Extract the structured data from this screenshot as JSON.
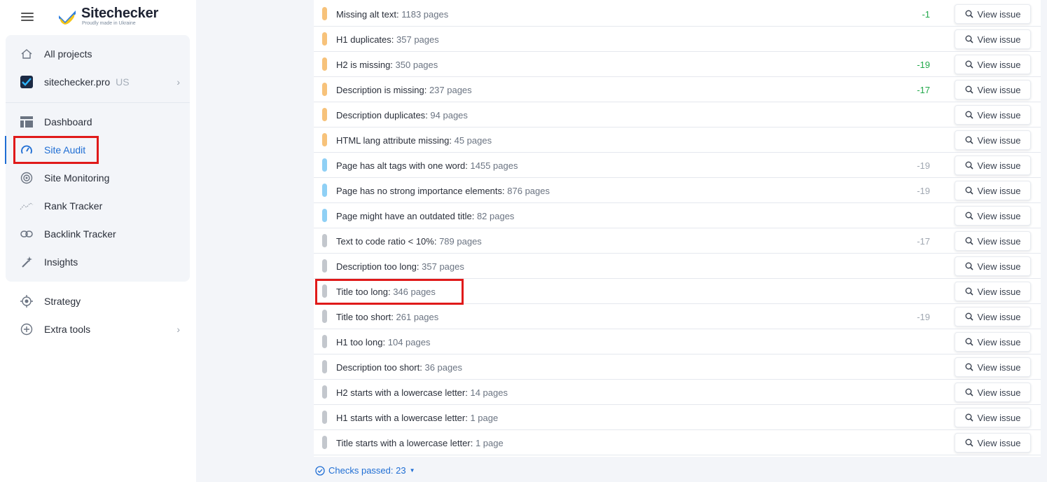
{
  "brand": {
    "name": "Sitechecker",
    "tagline": "Proudly made in Ukraine"
  },
  "sidebar": {
    "all_projects": "All projects",
    "project": {
      "name": "sitechecker.pro",
      "region": "US"
    },
    "items": [
      {
        "label": "Dashboard",
        "icon": "dashboard-icon"
      },
      {
        "label": "Site Audit",
        "icon": "gauge-icon"
      },
      {
        "label": "Site Monitoring",
        "icon": "monitoring-icon"
      },
      {
        "label": "Rank Tracker",
        "icon": "rank-icon"
      },
      {
        "label": "Backlink Tracker",
        "icon": "link-icon"
      },
      {
        "label": "Insights",
        "icon": "magic-wand-icon"
      }
    ],
    "strategy": "Strategy",
    "extra_tools": "Extra tools"
  },
  "colors": {
    "accent": "#1f6ed4",
    "warning": "#f7c27a",
    "notice": "#8fd0f5",
    "info": "#c3c7cd",
    "positive": "#21a84a",
    "neutral": "#a0a7b1",
    "highlight": "#e01a1a"
  },
  "issues": [
    {
      "name": "Missing alt text",
      "count": "1183 pages",
      "delta": "-1",
      "level": "warning",
      "delta_kind": "positive"
    },
    {
      "name": "H1 duplicates",
      "count": "357 pages",
      "delta": "",
      "level": "warning",
      "delta_kind": ""
    },
    {
      "name": "H2 is missing",
      "count": "350 pages",
      "delta": "-19",
      "level": "warning",
      "delta_kind": "positive"
    },
    {
      "name": "Description is missing",
      "count": "237 pages",
      "delta": "-17",
      "level": "warning",
      "delta_kind": "positive"
    },
    {
      "name": "Description duplicates",
      "count": "94 pages",
      "delta": "",
      "level": "warning",
      "delta_kind": ""
    },
    {
      "name": "HTML lang attribute missing",
      "count": "45 pages",
      "delta": "",
      "level": "warning",
      "delta_kind": ""
    },
    {
      "name": "Page has alt tags with one word",
      "count": "1455 pages",
      "delta": "-19",
      "level": "notice",
      "delta_kind": "neutral"
    },
    {
      "name": "Page has no strong importance elements",
      "count": "876 pages",
      "delta": "-19",
      "level": "notice",
      "delta_kind": "neutral"
    },
    {
      "name": "Page might have an outdated title",
      "count": "82 pages",
      "delta": "",
      "level": "notice",
      "delta_kind": ""
    },
    {
      "name": "Text to code ratio < 10%",
      "count": "789 pages",
      "delta": "-17",
      "level": "info",
      "delta_kind": "neutral"
    },
    {
      "name": "Description too long",
      "count": "357 pages",
      "delta": "",
      "level": "info",
      "delta_kind": ""
    },
    {
      "name": "Title too long",
      "count": "346 pages",
      "delta": "",
      "level": "info",
      "delta_kind": ""
    },
    {
      "name": "Title too short",
      "count": "261 pages",
      "delta": "-19",
      "level": "info",
      "delta_kind": "neutral"
    },
    {
      "name": "H1 too long",
      "count": "104 pages",
      "delta": "",
      "level": "info",
      "delta_kind": ""
    },
    {
      "name": "Description too short",
      "count": "36 pages",
      "delta": "",
      "level": "info",
      "delta_kind": ""
    },
    {
      "name": "H2 starts with a lowercase letter",
      "count": "14 pages",
      "delta": "",
      "level": "info",
      "delta_kind": ""
    },
    {
      "name": "H1 starts with a lowercase letter",
      "count": "1 page",
      "delta": "",
      "level": "info",
      "delta_kind": ""
    },
    {
      "name": "Title starts with a lowercase letter",
      "count": "1 page",
      "delta": "",
      "level": "info",
      "delta_kind": ""
    }
  ],
  "view_issue_label": "View issue",
  "checks_passed": "Checks passed: 23"
}
